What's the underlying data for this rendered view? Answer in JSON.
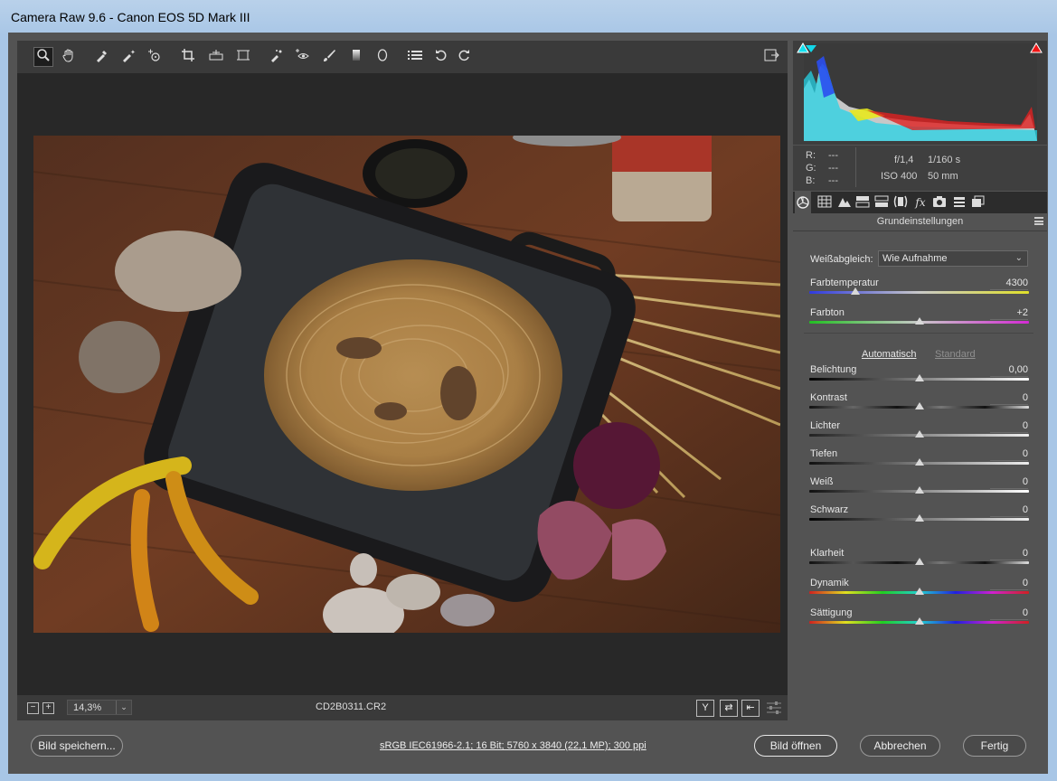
{
  "window": {
    "title": "Camera Raw 9.6 - Canon EOS 5D Mark III"
  },
  "toolbar": {
    "tools": [
      "zoom-icon",
      "hand-icon",
      "white-balance-icon",
      "color-sampler-icon",
      "targeted-adjustment-icon",
      "crop-icon",
      "straighten-icon",
      "transform-icon",
      "spot-removal-icon",
      "red-eye-icon",
      "adjustment-brush-icon",
      "graduated-filter-icon",
      "radial-filter-icon",
      "preferences-icon",
      "rotate-ccw-icon",
      "rotate-cw-icon"
    ],
    "fullscreen_icon": "toggle-fullscreen-icon"
  },
  "status": {
    "zoom_value": "14,3%",
    "filename": "CD2B0311.CR2",
    "zoom_out_label": "−",
    "zoom_in_label": "+",
    "view_btn_label": "Y",
    "swap_btn_label": "⇄",
    "copy_btn_label": "⇤"
  },
  "histogram": {
    "r_label": "R:",
    "r_value": "---",
    "g_label": "G:",
    "g_value": "---",
    "b_label": "B:",
    "b_value": "---",
    "aperture": "f/1,4",
    "shutter": "1/160 s",
    "iso": "ISO 400",
    "focal": "50 mm"
  },
  "panel": {
    "title": "Grundeinstellungen",
    "white_balance_label": "Weißabgleich:",
    "white_balance_value": "Wie Aufnahme",
    "auto_label": "Automatisch",
    "default_label": "Standard",
    "sliders": [
      {
        "label": "Farbtemperatur",
        "value": "4300",
        "pos": 0.21
      },
      {
        "label": "Farbton",
        "value": "+2",
        "pos": 0.5
      },
      {
        "label": "Belichtung",
        "value": "0,00",
        "pos": 0.5
      },
      {
        "label": "Kontrast",
        "value": "0",
        "pos": 0.5
      },
      {
        "label": "Lichter",
        "value": "0",
        "pos": 0.5
      },
      {
        "label": "Tiefen",
        "value": "0",
        "pos": 0.5
      },
      {
        "label": "Weiß",
        "value": "0",
        "pos": 0.5
      },
      {
        "label": "Schwarz",
        "value": "0",
        "pos": 0.5
      },
      {
        "label": "Klarheit",
        "value": "0",
        "pos": 0.5
      },
      {
        "label": "Dynamik",
        "value": "0",
        "pos": 0.5
      },
      {
        "label": "Sättigung",
        "value": "0",
        "pos": 0.5
      }
    ]
  },
  "footer": {
    "save_label": "Bild speichern...",
    "workflow_info": "sRGB IEC61966-2.1; 16 Bit; 5760 x 3840 (22,1 MP); 300 ppi",
    "open_label": "Bild öffnen",
    "cancel_label": "Abbrechen",
    "done_label": "Fertig"
  }
}
